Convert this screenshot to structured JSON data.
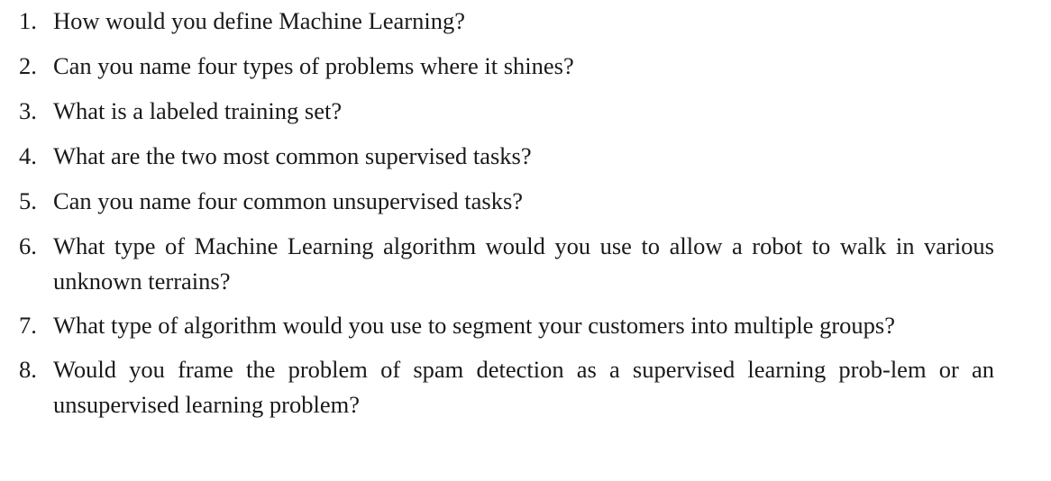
{
  "questions": [
    {
      "number": "1.",
      "text": "How would you define Machine Learning?"
    },
    {
      "number": "2.",
      "text": "Can you name four types of problems where it shines?"
    },
    {
      "number": "3.",
      "text": "What is a labeled training set?"
    },
    {
      "number": "4.",
      "text": "What are the two most common supervised tasks?"
    },
    {
      "number": "5.",
      "text": "Can you name four common unsupervised tasks?"
    },
    {
      "number": "6.",
      "text": "What type of Machine Learning algorithm would you use to allow a robot to walk in various unknown terrains?"
    },
    {
      "number": "7.",
      "text": "What type of algorithm would you use to segment your customers into multiple groups?"
    },
    {
      "number": "8.",
      "text": "Would you frame the problem of spam detection as a supervised learning prob-lem or an unsupervised learning problem?"
    }
  ]
}
